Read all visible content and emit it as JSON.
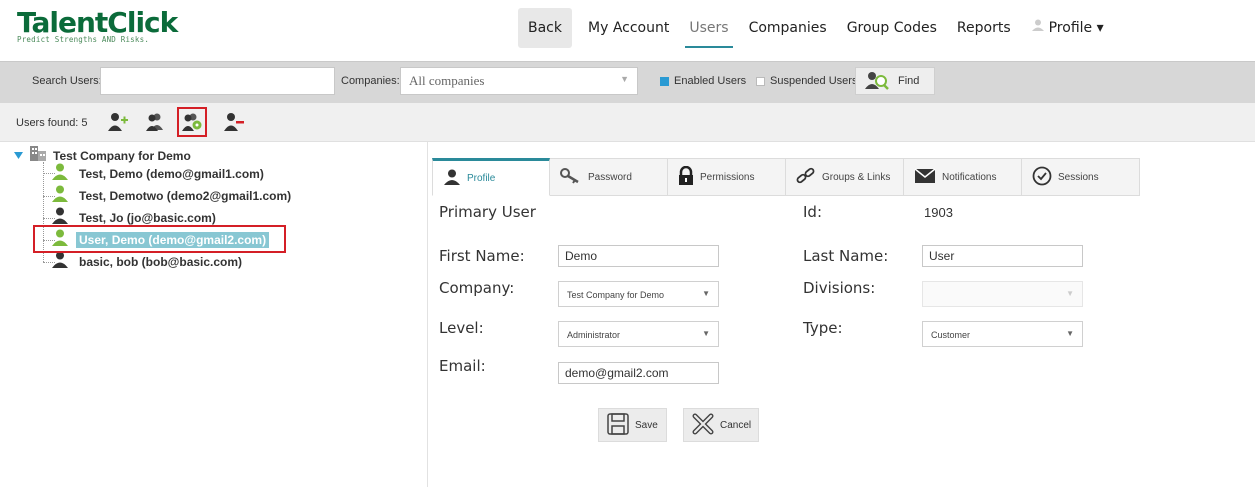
{
  "brand": {
    "title": "TalentClick",
    "tagline": "Predict Strengths AND Risks."
  },
  "nav": {
    "back": "Back",
    "my_account": "My Account",
    "users": "Users",
    "companies": "Companies",
    "group_codes": "Group Codes",
    "reports": "Reports",
    "profile": "Profile ▾"
  },
  "search": {
    "label": "Search Users:",
    "value": "",
    "companies_label": "Companies:",
    "companies_value": "All companies",
    "enabled_label": "Enabled Users",
    "suspended_label": "Suspended Users",
    "find_label": "Find"
  },
  "users_bar": {
    "label": "Users found: 5"
  },
  "tree": {
    "root": "Test Company for Demo",
    "users": [
      {
        "label": "Test, Demo  (demo@gmail1.com)",
        "status": "enabled"
      },
      {
        "label": "Test, Demotwo  (demo2@gmail1.com)",
        "status": "enabled"
      },
      {
        "label": "Test, Jo  (jo@basic.com)",
        "status": "basic"
      },
      {
        "label": "User, Demo  (demo@gmail2.com)",
        "status": "enabled"
      },
      {
        "label": "basic, bob  (bob@basic.com)",
        "status": "basic"
      }
    ]
  },
  "tabs": [
    "Profile",
    "Password",
    "Permissions",
    "Groups & Links",
    "Notifications",
    "Sessions"
  ],
  "form": {
    "heading": "Primary User",
    "id_label": "Id:",
    "id_value": "1903",
    "first_name_label": "First Name:",
    "first_name_value": "Demo",
    "last_name_label": "Last Name:",
    "last_name_value": "User",
    "company_label": "Company:",
    "company_value": "Test Company for Demo",
    "divisions_label": "Divisions:",
    "divisions_value": "",
    "level_label": "Level:",
    "level_value": "Administrator",
    "type_label": "Type:",
    "type_value": "Customer",
    "email_label": "Email:",
    "email_value": "demo@gmail2.com",
    "save_label": "Save",
    "cancel_label": "Cancel"
  },
  "colors": {
    "brand_green": "#0b6b3a",
    "accent_teal": "#2a8a9a",
    "selection_blue": "#88c7d3",
    "highlight_red": "#d41f26",
    "user_green": "#7cba3c"
  }
}
